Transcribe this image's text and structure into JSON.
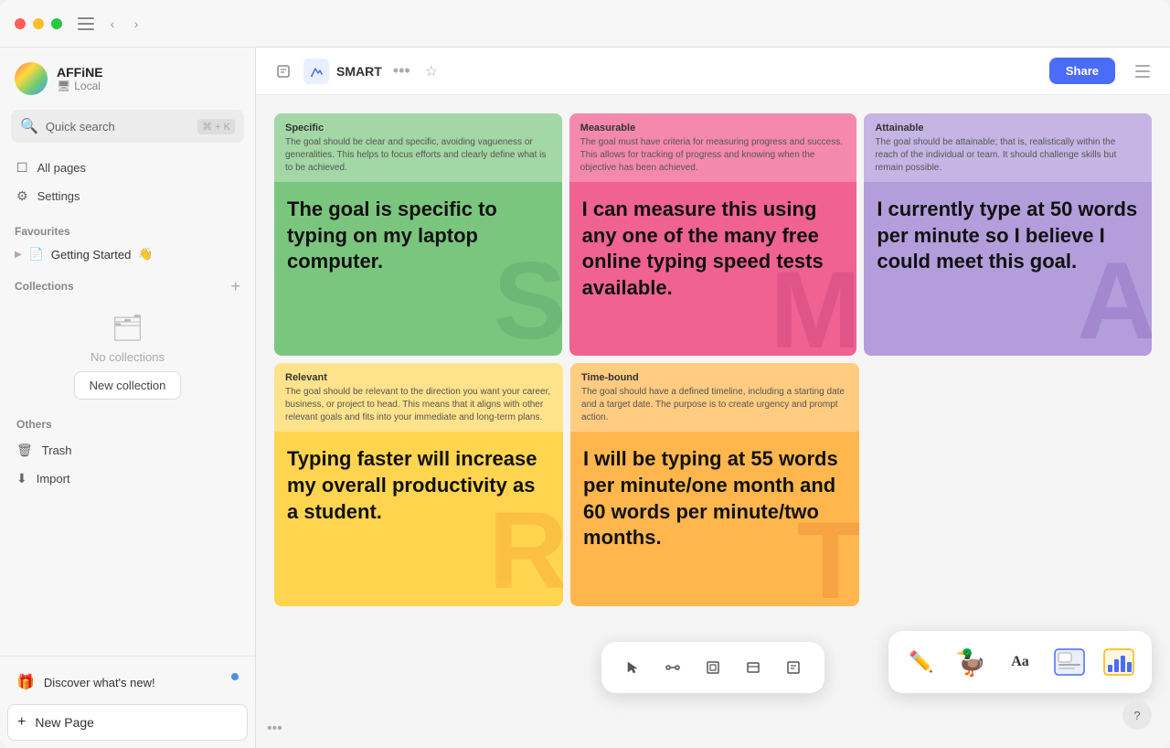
{
  "app": {
    "name": "AFFiNE",
    "workspace": "Local"
  },
  "topbar": {
    "page_icon": "📄",
    "edgeless_icon": "✏️",
    "title": "SMART",
    "more_label": "•••",
    "star_label": "☆",
    "share_label": "Share"
  },
  "sidebar": {
    "search": {
      "placeholder": "Quick search",
      "shortcut": "⌘ + K"
    },
    "nav": [
      {
        "id": "all-pages",
        "label": "All pages",
        "icon": "📄"
      },
      {
        "id": "settings",
        "label": "Settings",
        "icon": "⚙️"
      }
    ],
    "favourites": {
      "title": "Favourites",
      "items": [
        {
          "id": "getting-started",
          "label": "Getting Started",
          "emoji": "👋"
        }
      ]
    },
    "collections": {
      "title": "Collections",
      "empty_text": "No collections",
      "new_collection_label": "New collection"
    },
    "others": {
      "title": "Others",
      "items": [
        {
          "id": "trash",
          "label": "Trash",
          "icon": "🗑️"
        },
        {
          "id": "import",
          "label": "Import",
          "icon": "⬇️"
        }
      ]
    },
    "discover": {
      "label": "Discover what's new!",
      "icon": "🎁",
      "has_badge": true
    },
    "new_page": {
      "label": "New Page",
      "icon": "+"
    }
  },
  "cards": {
    "row1": [
      {
        "id": "specific",
        "color": "green",
        "header_label": "Specific",
        "header_desc": "The goal should be clear and specific, avoiding vagueness or generalities. This helps to focus efforts and clearly define what is to be achieved.",
        "body_text": "The goal is specific to typing on my laptop computer.",
        "watermark": "S"
      },
      {
        "id": "measurable",
        "color": "pink",
        "header_label": "Measurable",
        "header_desc": "The goal must have criteria for measuring progress and success. This allows for tracking of progress and knowing when the objective has been achieved.",
        "body_text": "I can measure this using any one of the many free online typing speed tests available.",
        "watermark": "M"
      },
      {
        "id": "attainable",
        "color": "purple",
        "header_label": "Attainable",
        "header_desc": "The goal should be attainable; that is, realistically within the reach of the individual or team. It should challenge skills but remain possible.",
        "body_text": "I currently type at 50 words per minute so I believe I could meet this goal.",
        "watermark": "A"
      }
    ],
    "row2": [
      {
        "id": "relevant",
        "color": "yellow",
        "header_label": "Relevant",
        "header_desc": "The goal should be relevant to the direction you want your career, business, or project to head. This means that it aligns with other relevant goals and fits into your immediate and long-term plans.",
        "body_text": "Typing faster will increase my overall productivity as a student.",
        "watermark": "R"
      },
      {
        "id": "timebound",
        "color": "orange",
        "header_label": "Time-bound",
        "header_desc": "The goal should have a defined timeline, including a starting date and a target date. The purpose is to create urgency and prompt action.",
        "body_text": "I will be typing at 55 words per minute/one month and 60 words per minute/two months.",
        "watermark": "T"
      }
    ]
  },
  "toolbar": {
    "tools": [
      {
        "id": "select",
        "icon": "↖",
        "label": "Select"
      },
      {
        "id": "connect",
        "icon": "⋯",
        "label": "Connect"
      },
      {
        "id": "frame",
        "icon": "⊞",
        "label": "Frame"
      },
      {
        "id": "embed",
        "icon": "⊟",
        "label": "Embed"
      },
      {
        "id": "note",
        "icon": "📝",
        "label": "Note"
      }
    ],
    "right_tools": [
      {
        "id": "pencil",
        "icon": "✏️"
      },
      {
        "id": "duck",
        "icon": "🦆"
      },
      {
        "id": "text-aa",
        "label": "Aa"
      },
      {
        "id": "image",
        "icon": "🖼️"
      },
      {
        "id": "chart",
        "icon": "📊"
      }
    ]
  },
  "colors": {
    "accent": "#4a6cf7",
    "green_card": "#7bc67e",
    "pink_card": "#f06292",
    "purple_card": "#b39ddb",
    "yellow_card": "#ffd54f",
    "orange_card": "#ffb74d"
  }
}
